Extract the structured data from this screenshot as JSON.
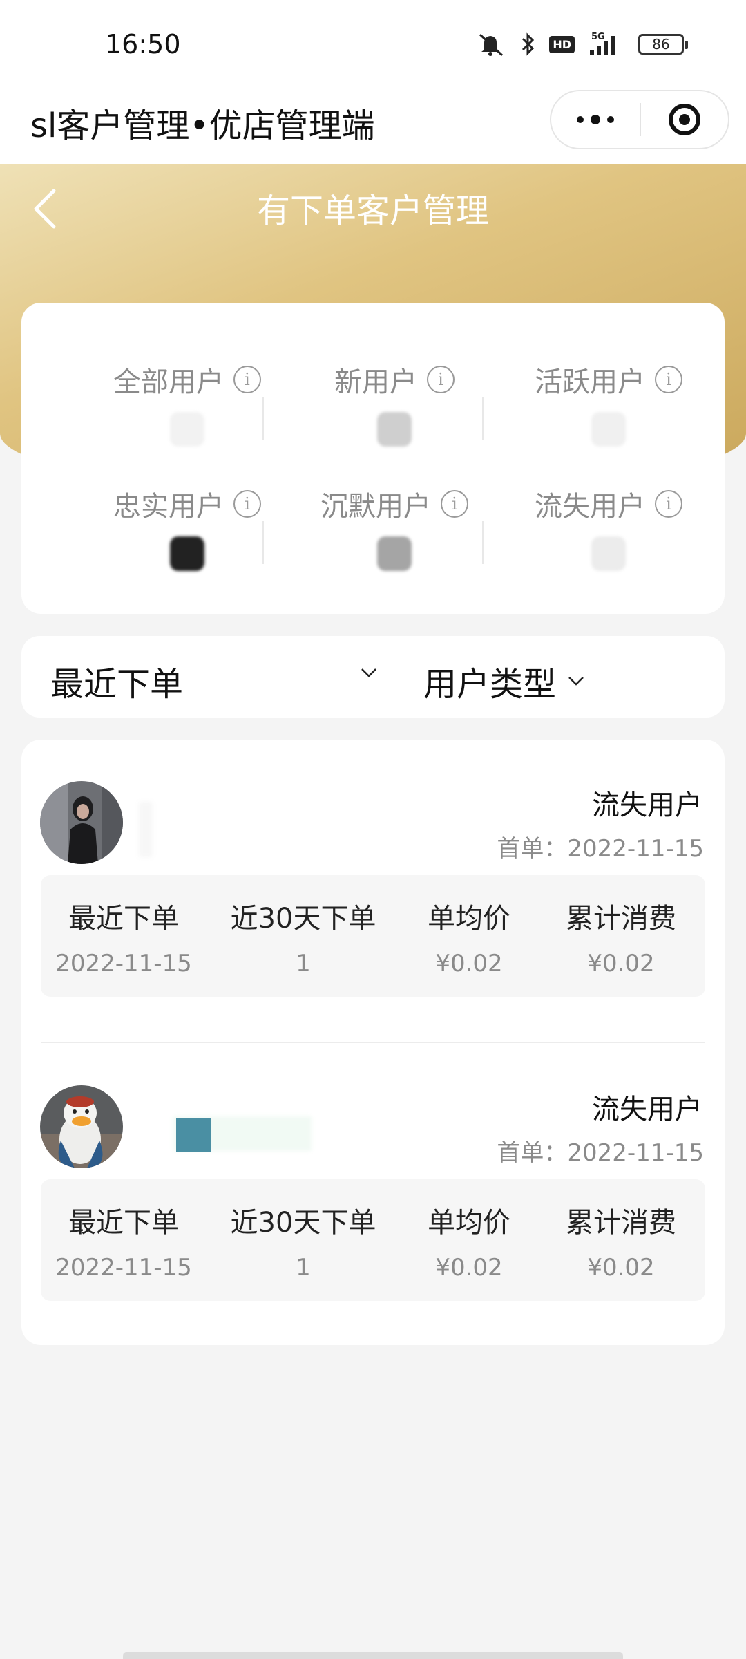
{
  "status_bar": {
    "time": "16:50",
    "hd": "HD",
    "network": "5G",
    "battery": "86"
  },
  "mini_program": {
    "title": "sl客户管理•优店管理端"
  },
  "page": {
    "title": "有下单客户管理"
  },
  "stats": {
    "items": [
      {
        "label": "全部用户",
        "info": "i"
      },
      {
        "label": "新用户",
        "info": "i"
      },
      {
        "label": "活跃用户",
        "info": "i"
      },
      {
        "label": "忠实用户",
        "info": "i"
      },
      {
        "label": "沉默用户",
        "info": "i"
      },
      {
        "label": "流失用户",
        "info": "i"
      }
    ]
  },
  "filters": {
    "sort_label": "最近下单",
    "type_label": "用户类型"
  },
  "customers": [
    {
      "type": "流失用户",
      "first_order": "首单：2022-11-15",
      "metrics": [
        {
          "label": "最近下单",
          "value": "2022-11-15"
        },
        {
          "label": "近30天下单",
          "value": "1"
        },
        {
          "label": "单均价",
          "value": "¥0.02"
        },
        {
          "label": "累计消费",
          "value": "¥0.02"
        }
      ]
    },
    {
      "type": "流失用户",
      "first_order": "首单：2022-11-15",
      "metrics": [
        {
          "label": "最近下单",
          "value": "2022-11-15"
        },
        {
          "label": "近30天下单",
          "value": "1"
        },
        {
          "label": "单均价",
          "value": "¥0.02"
        },
        {
          "label": "累计消费",
          "value": "¥0.02"
        }
      ]
    }
  ],
  "colors": {
    "gold_light": "#efe1b6",
    "gold_dark": "#c9a65a",
    "background": "#f4f4f4",
    "accent_teal": "#4a8fa3"
  }
}
